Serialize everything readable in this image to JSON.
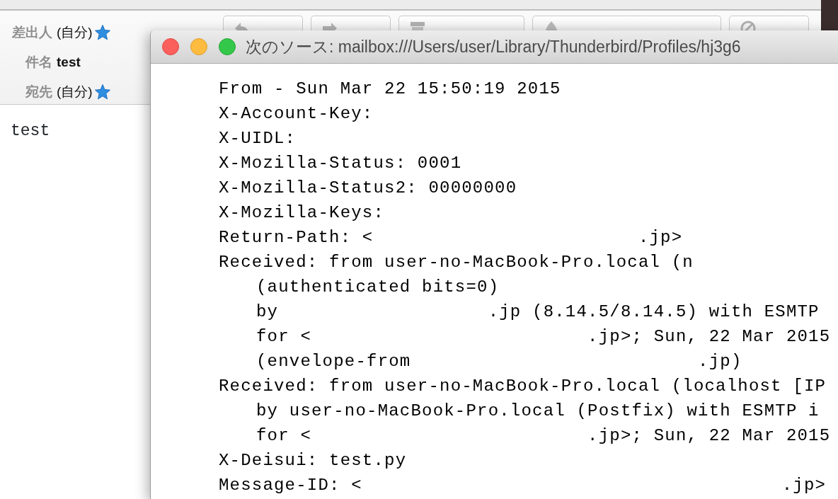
{
  "mail": {
    "toolbar_buttons": [
      {
        "kind": "reply"
      },
      {
        "kind": "forward"
      },
      {
        "kind": "archive"
      },
      {
        "kind": "junk"
      },
      {
        "kind": "delete"
      }
    ],
    "headers": [
      {
        "label": "差出人",
        "value": "(自分)",
        "kind": "address"
      },
      {
        "label": "件名",
        "value": "test",
        "kind": "subject"
      },
      {
        "label": "宛先",
        "value": "(自分)",
        "kind": "address"
      }
    ],
    "body": "test"
  },
  "source_window": {
    "title": "次のソース: mailbox:///Users/user/Library/Thunderbird/Profiles/hj3g6",
    "lines": [
      {
        "text": "From - Sun Mar 22 15:50:19 2015"
      },
      {
        "text": "X-Account-Key:"
      },
      {
        "text": "X-UIDL:"
      },
      {
        "text": "X-Mozilla-Status: 0001"
      },
      {
        "text": "X-Mozilla-Status2: 00000000"
      },
      {
        "text": "X-Mozilla-Keys:"
      },
      {
        "text": "Return-Path: <                        .jp>"
      },
      {
        "text": "Received: from user-no-MacBook-Pro.local (n",
        "children": [
          {
            "text": "(authenticated bits=0)"
          },
          {
            "text": "by                   .jp (8.14.5/8.14.5) with ESMTP"
          },
          {
            "text": "for <                         .jp>; Sun, 22 Mar 2015"
          },
          {
            "text": "(envelope-from                          .jp)"
          }
        ]
      },
      {
        "text": "Received: from user-no-MacBook-Pro.local (localhost [IP",
        "children": [
          {
            "text": "by user-no-MacBook-Pro.local (Postfix) with ESMTP i"
          },
          {
            "text": "for <                         .jp>; Sun, 22 Mar 2015"
          }
        ]
      },
      {
        "text": "X-Deisui: test.py"
      },
      {
        "text": "Message-ID: <                                      .jp>"
      }
    ]
  }
}
